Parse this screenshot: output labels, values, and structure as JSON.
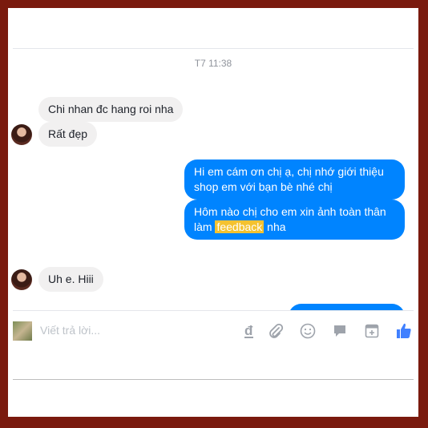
{
  "conversation": {
    "timestamp": "T7 11:38",
    "messages": [
      {
        "id": "m1",
        "from": "them",
        "text": "Chi nhan đc hang roi nha"
      },
      {
        "id": "m2",
        "from": "them",
        "text": "Rất đẹp"
      },
      {
        "id": "m3",
        "from": "me",
        "lines": [
          "Hi em cám ơn chị ạ, chị nhớ giới thiệu",
          "shop em với bạn bè nhé chị"
        ]
      },
      {
        "id": "m4",
        "from": "me",
        "line1": "Hôm nào chị cho em xin ảnh toàn thân",
        "line2_prefix": "làm ",
        "line2_highlight": "feedback",
        "line2_suffix": " nha"
      },
      {
        "id": "m5",
        "from": "them",
        "text": "Uh e. Hiii"
      }
    ]
  },
  "composer": {
    "placeholder": "Viết trả lời...",
    "tools": [
      "currency-icon",
      "attach-icon",
      "emoji-icon",
      "sticker-icon",
      "gif-icon",
      "like-icon"
    ]
  },
  "colors": {
    "outgoing_bubble": "#0084ff",
    "incoming_bubble": "#f1f0f0",
    "highlight": "#f4c230",
    "frame_border": "#7a1a0e",
    "icon_gray": "#9ea3ab",
    "like_blue": "#4080ff"
  }
}
